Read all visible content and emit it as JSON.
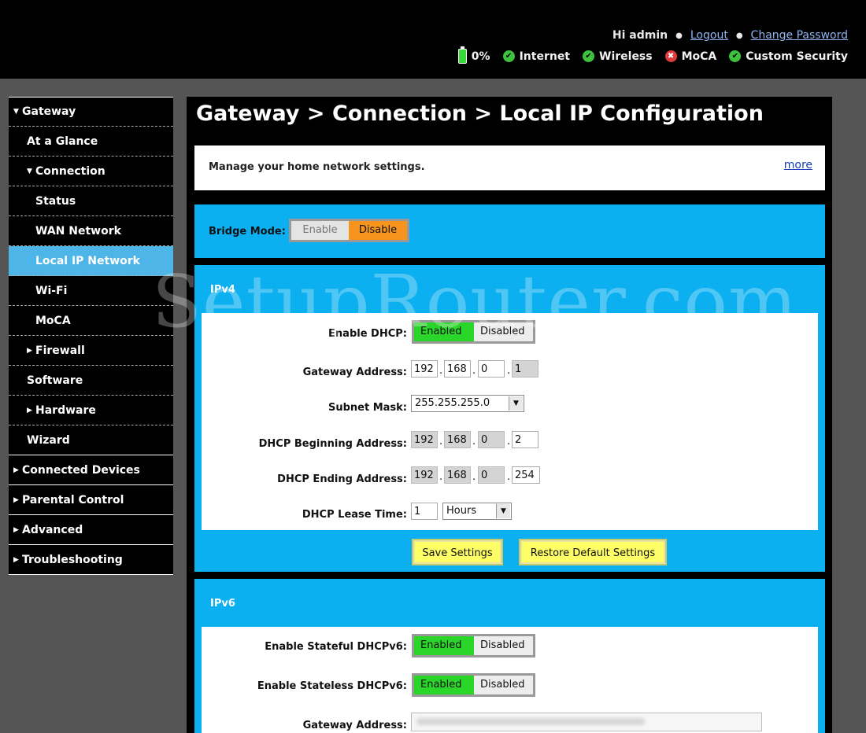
{
  "header": {
    "greeting": "Hi admin",
    "logout": "Logout",
    "change_password": "Change Password",
    "status": {
      "battery": "0%",
      "items": [
        {
          "label": "Internet",
          "state": "ok"
        },
        {
          "label": "Wireless",
          "state": "ok"
        },
        {
          "label": "MoCA",
          "state": "error"
        },
        {
          "label": "Custom Security",
          "state": "ok"
        }
      ]
    }
  },
  "sidebar": {
    "items": [
      {
        "label": "Gateway",
        "caret": "down"
      },
      {
        "label": "At a Glance"
      },
      {
        "label": "Connection",
        "caret": "down"
      },
      {
        "label": "Status"
      },
      {
        "label": "WAN Network"
      },
      {
        "label": "Local IP Network",
        "active": true
      },
      {
        "label": "Wi-Fi"
      },
      {
        "label": "MoCA"
      },
      {
        "label": "Firewall",
        "caret": "right"
      },
      {
        "label": "Software"
      },
      {
        "label": "Hardware",
        "caret": "right"
      },
      {
        "label": "Wizard"
      },
      {
        "label": "Connected Devices",
        "caret": "right"
      },
      {
        "label": "Parental Control",
        "caret": "right"
      },
      {
        "label": "Advanced",
        "caret": "right"
      },
      {
        "label": "Troubleshooting",
        "caret": "right"
      }
    ]
  },
  "main": {
    "title": "Gateway > Connection > Local IP Configuration",
    "intro": "Manage your home network settings.",
    "more": "more",
    "bridge": {
      "label": "Bridge Mode:",
      "enable": "Enable",
      "disable": "Disable"
    },
    "ipv4": {
      "title": "IPv4",
      "enable_dhcp_label": "Enable DHCP:",
      "enabled": "Enabled",
      "disabled": "Disabled",
      "gateway_label": "Gateway Address:",
      "gateway": [
        "192",
        "168",
        "0",
        "1"
      ],
      "subnet_label": "Subnet Mask:",
      "subnet": "255.255.255.0",
      "begin_label": "DHCP Beginning Address:",
      "begin": [
        "192",
        "168",
        "0",
        "2"
      ],
      "end_label": "DHCP Ending Address:",
      "end": [
        "192",
        "168",
        "0",
        "254"
      ],
      "lease_label": "DHCP Lease Time:",
      "lease_value": "1",
      "lease_unit": "Hours",
      "save": "Save Settings",
      "restore": "Restore Default Settings"
    },
    "ipv6": {
      "title": "IPv6",
      "stateful_label": "Enable Stateful DHCPv6:",
      "stateless_label": "Enable Stateless DHCPv6:",
      "enabled": "Enabled",
      "disabled": "Disabled",
      "gateway_label": "Gateway Address:"
    }
  },
  "watermark": "SetupRouter.com"
}
